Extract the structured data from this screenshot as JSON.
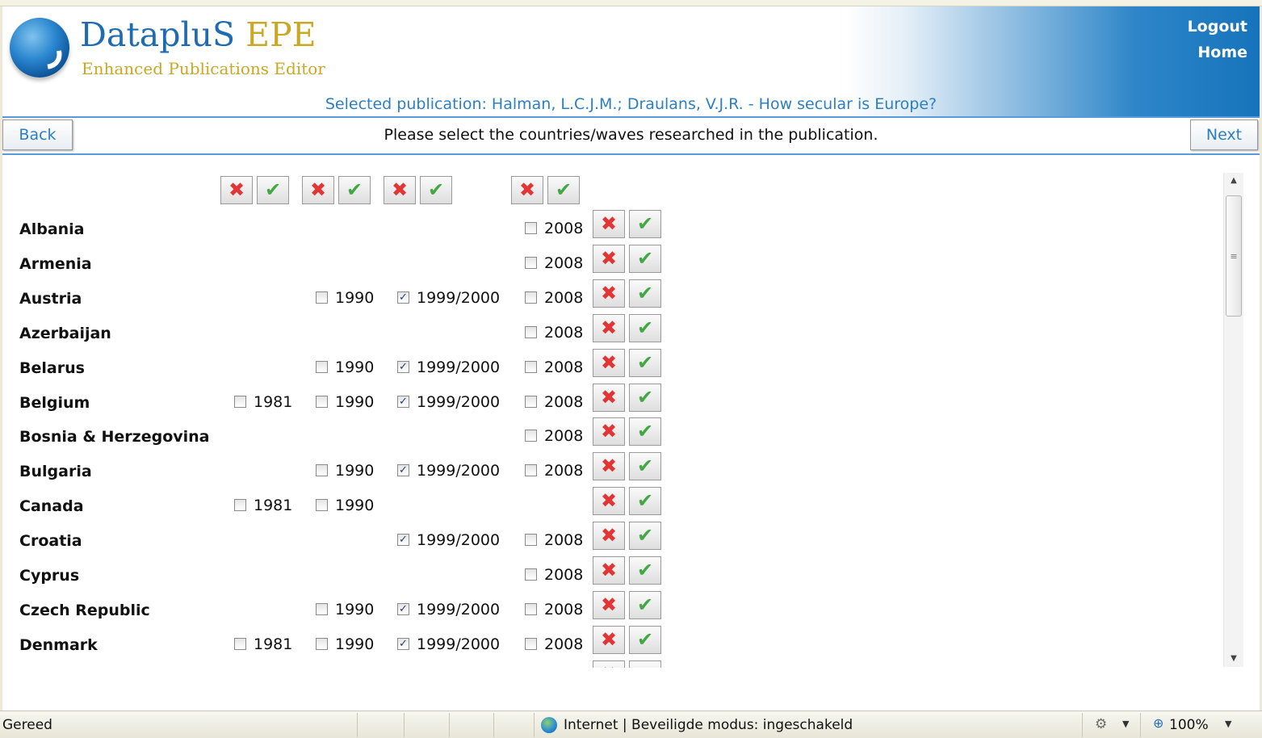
{
  "header": {
    "brand_name": "DatapluS",
    "brand_suffix": "EPE",
    "brand_subtitle": "Enhanced Publications Editor",
    "links": {
      "logout": "Logout",
      "home": "Home"
    },
    "selected_publication": "Selected publication: Halman, L.C.J.M.; Draulans, V.J.R. - How secular is Europe?"
  },
  "nav": {
    "back_label": "Back",
    "next_label": "Next",
    "instruction": "Please select the countries/waves researched in the publication."
  },
  "icons": {
    "deselect_symbol": "✖",
    "select_symbol": "✔",
    "checked_symbol": "✓",
    "deselect_icon": "red-cross-icon",
    "select_icon": "green-check-icon"
  },
  "colors": {
    "accent_blue": "#2c7fc4",
    "brand_gold": "#c9a825",
    "deselect_red": "#e23535",
    "select_green": "#43a843"
  },
  "countries": [
    {
      "name": "Albania",
      "waves": {
        "2008": false
      }
    },
    {
      "name": "Armenia",
      "waves": {
        "2008": false
      }
    },
    {
      "name": "Austria",
      "waves": {
        "1990": false,
        "1999/2000": true,
        "2008": false
      }
    },
    {
      "name": "Azerbaijan",
      "waves": {
        "2008": false
      }
    },
    {
      "name": "Belarus",
      "waves": {
        "1990": false,
        "1999/2000": true,
        "2008": false
      }
    },
    {
      "name": "Belgium",
      "waves": {
        "1981": false,
        "1990": false,
        "1999/2000": true,
        "2008": false
      }
    },
    {
      "name": "Bosnia & Herzegovina",
      "waves": {
        "2008": false
      }
    },
    {
      "name": "Bulgaria",
      "waves": {
        "1990": false,
        "1999/2000": true,
        "2008": false
      }
    },
    {
      "name": "Canada",
      "waves": {
        "1981": false,
        "1990": false
      }
    },
    {
      "name": "Croatia",
      "waves": {
        "1999/2000": true,
        "2008": false
      }
    },
    {
      "name": "Cyprus",
      "waves": {
        "2008": false
      }
    },
    {
      "name": "Czech Republic",
      "waves": {
        "1990": false,
        "1999/2000": true,
        "2008": false
      }
    },
    {
      "name": "Denmark",
      "waves": {
        "1981": false,
        "1990": false,
        "1999/2000": true,
        "2008": false
      }
    }
  ],
  "wave_years": [
    "1981",
    "1990",
    "1999/2000",
    "2008"
  ],
  "statusbar": {
    "ready": "Gereed",
    "zone": "Internet | Beveiligde modus: ingeschakeld",
    "zoom": "100%"
  }
}
